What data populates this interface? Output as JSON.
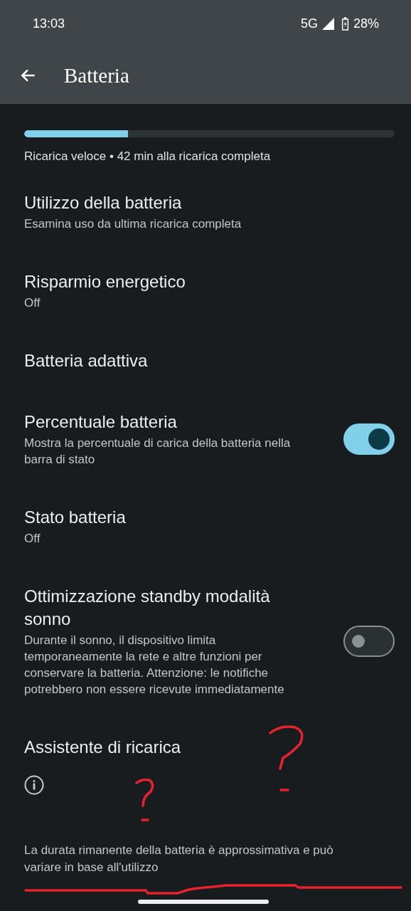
{
  "status_bar": {
    "time": "13:03",
    "network": "5G",
    "battery": "28%"
  },
  "app_bar": {
    "title": "Batteria"
  },
  "charge": {
    "level": 0.28,
    "text": "Ricarica veloce • 42 min alla ricarica completa"
  },
  "items": [
    {
      "kind": "nav",
      "title": "Utilizzo della batteria",
      "subtitle": "Esamina uso da ultima ricarica completa"
    },
    {
      "kind": "nav",
      "title": "Risparmio energetico",
      "subtitle": "Off"
    },
    {
      "kind": "nav",
      "title": "Batteria adattiva"
    },
    {
      "kind": "toggle",
      "title": "Percentuale batteria",
      "subtitle": "Mostra la percentuale di carica della batteria nella barra di stato",
      "on": true
    },
    {
      "kind": "nav",
      "title": "Stato batteria",
      "subtitle": "Off"
    },
    {
      "kind": "toggle",
      "title": "Ottimizzazione standby modalità sonno",
      "subtitle": "Durante il sonno, il dispositivo limita temporaneamente la rete e altre funzioni per conservare la batteria. Attenzione: le notifiche potrebbero non essere ricevute immediatamente",
      "on": false
    },
    {
      "kind": "nav",
      "title": "Assistente di ricarica"
    }
  ],
  "footer": {
    "text": "La durata rimanente della batteria è approssimativa e può variare in base all'utilizzo"
  }
}
